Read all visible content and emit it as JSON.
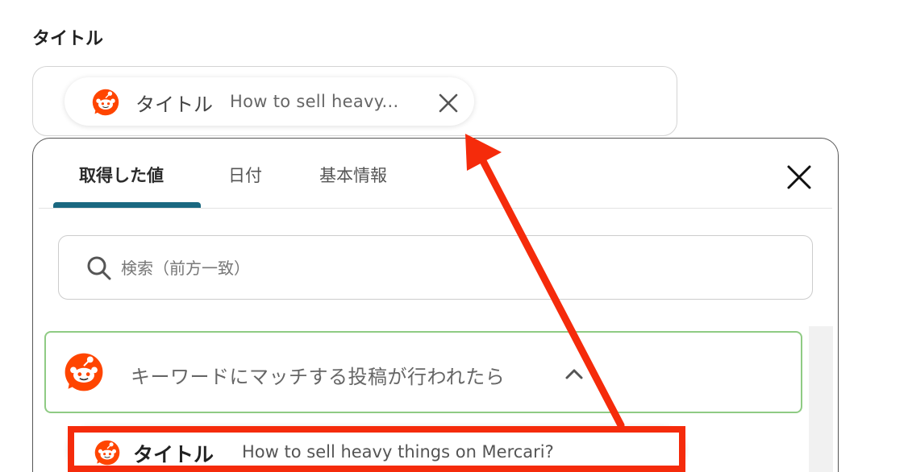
{
  "field": {
    "label": "タイトル",
    "chip": {
      "name": "タイトル",
      "value": "How to sell heavy...",
      "icon": "reddit-icon"
    }
  },
  "panel": {
    "tabs": [
      {
        "label": "取得した値",
        "active": true
      },
      {
        "label": "日付",
        "active": false
      },
      {
        "label": "基本情報",
        "active": false
      }
    ],
    "search": {
      "placeholder": "検索（前方一致）",
      "value": ""
    },
    "group": {
      "title": "キーワードにマッチする投稿が行われたら",
      "icon": "reddit-icon",
      "expanded": true
    },
    "items": [
      {
        "name": "タイトル",
        "value": "How to sell heavy things on Mercari?",
        "icon": "reddit-icon"
      }
    ]
  },
  "annotation": {
    "highlight_color": "#f52b0b",
    "arrow_color": "#f52b0b"
  },
  "colors": {
    "tab_accent": "#1a6880",
    "group_border": "#8fcb84",
    "reddit_orange": "#ff4500"
  }
}
